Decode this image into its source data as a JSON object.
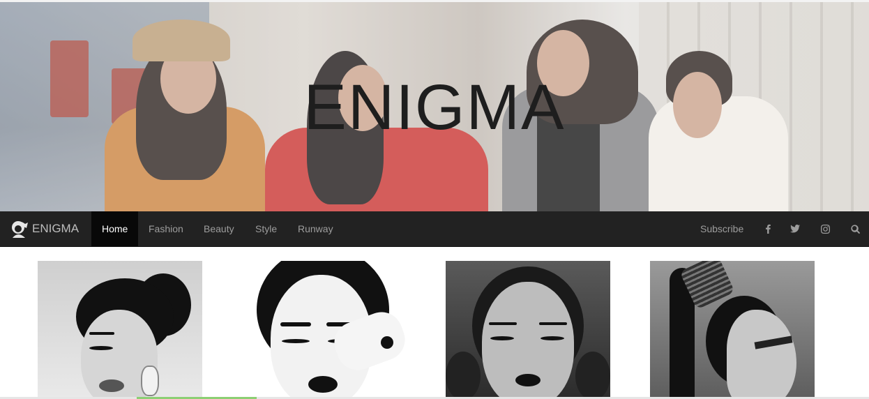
{
  "hero": {
    "title": "ENIGMA"
  },
  "nav": {
    "brand": "ENIGMA",
    "items": [
      {
        "label": "Home",
        "active": true
      },
      {
        "label": "Fashion",
        "active": false
      },
      {
        "label": "Beauty",
        "active": false
      },
      {
        "label": "Style",
        "active": false
      },
      {
        "label": "Runway",
        "active": false
      }
    ],
    "subscribe": "Subscribe",
    "icons": [
      "facebook-icon",
      "twitter-icon",
      "instagram-icon",
      "search-icon"
    ]
  },
  "gallery": [
    "bun-hairstyle-portrait",
    "hand-over-eye-portrait",
    "sleek-center-part-portrait",
    "high-ponytail-profile"
  ],
  "colors": {
    "nav_bg": "#222222",
    "nav_active_bg": "#080808",
    "nav_text": "#9d9d9d",
    "hero_title": "#1e1e1e"
  }
}
